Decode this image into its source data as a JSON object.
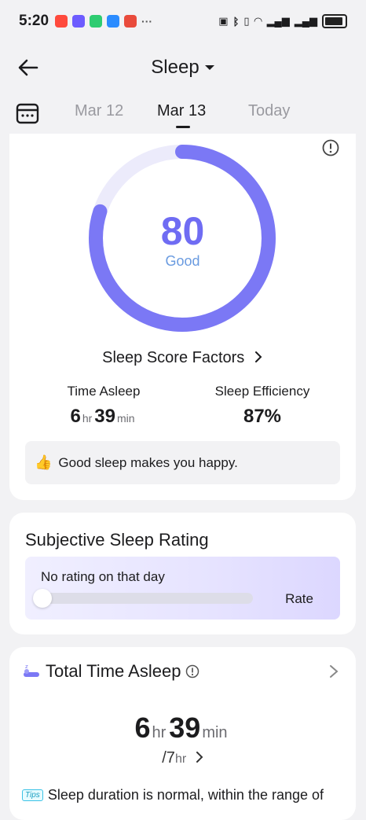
{
  "status_bar": {
    "time": "5:20",
    "more": "···"
  },
  "header": {
    "title": "Sleep"
  },
  "dates": {
    "prev": "Mar 12",
    "current": "Mar 13",
    "next": "Today"
  },
  "score_card": {
    "score": "80",
    "score_fraction": 0.8,
    "label": "Good",
    "factors_link": "Sleep Score Factors",
    "time_asleep": {
      "label": "Time Asleep",
      "hours": "6",
      "hours_unit": "hr",
      "minutes": "39",
      "minutes_unit": "min"
    },
    "efficiency": {
      "label": "Sleep Efficiency",
      "value": "87%"
    },
    "tip": "Good sleep makes you happy."
  },
  "rating_card": {
    "title": "Subjective Sleep Rating",
    "status": "No rating on that day",
    "rate_label": "Rate"
  },
  "total_card": {
    "title": "Total Time Asleep",
    "hours": "6",
    "hours_unit": "hr",
    "minutes": "39",
    "minutes_unit": "min",
    "goal_value": "/7",
    "goal_unit": "hr",
    "tips_badge": "Tips",
    "tips_text": "Sleep duration is normal, within the range of"
  },
  "colors": {
    "ring": "#7b78f5",
    "ring_track": "#ecebfb",
    "score": "#6f6cf3",
    "label": "#6a9be0"
  }
}
